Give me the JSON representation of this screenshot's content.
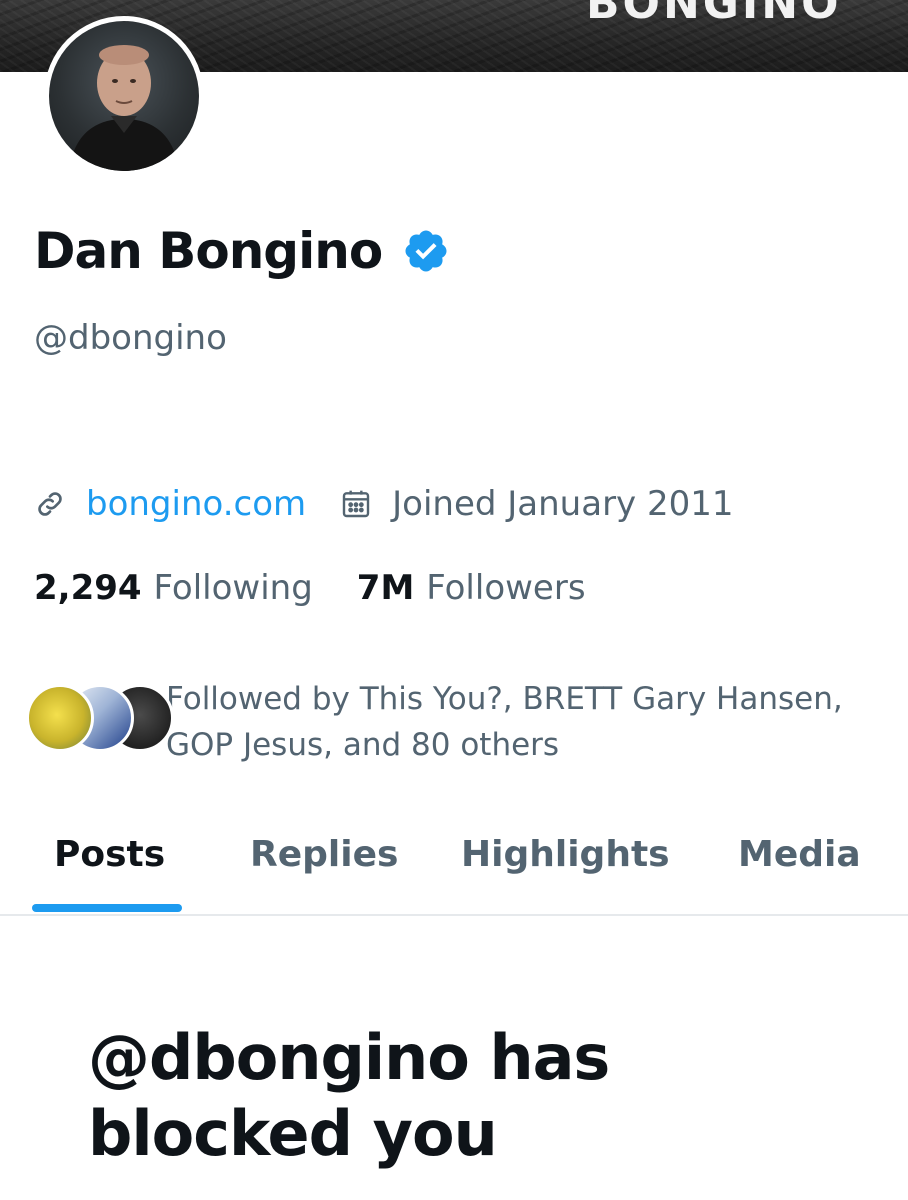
{
  "banner": {
    "text": "BONGINO"
  },
  "profile": {
    "display_name": "Dan Bongino",
    "verified_icon": "verified-badge-icon",
    "handle": "@dbongino",
    "website": "bongino.com",
    "joined": "Joined January 2011",
    "following_count": "2,294",
    "following_label": "Following",
    "followers_count": "7M",
    "followers_label": "Followers",
    "followed_by": "Followed by This You?, BRETT Gary Hansen, GOP Jesus, and 80 others"
  },
  "tabs": [
    {
      "label": "Posts",
      "active": true
    },
    {
      "label": "Replies",
      "active": false
    },
    {
      "label": "Highlights",
      "active": false
    },
    {
      "label": "Media",
      "active": false
    }
  ],
  "blocked_message": "@dbongino has blocked you",
  "colors": {
    "accent": "#1d9bf0",
    "text_primary": "#0f1419",
    "text_secondary": "#536471"
  }
}
